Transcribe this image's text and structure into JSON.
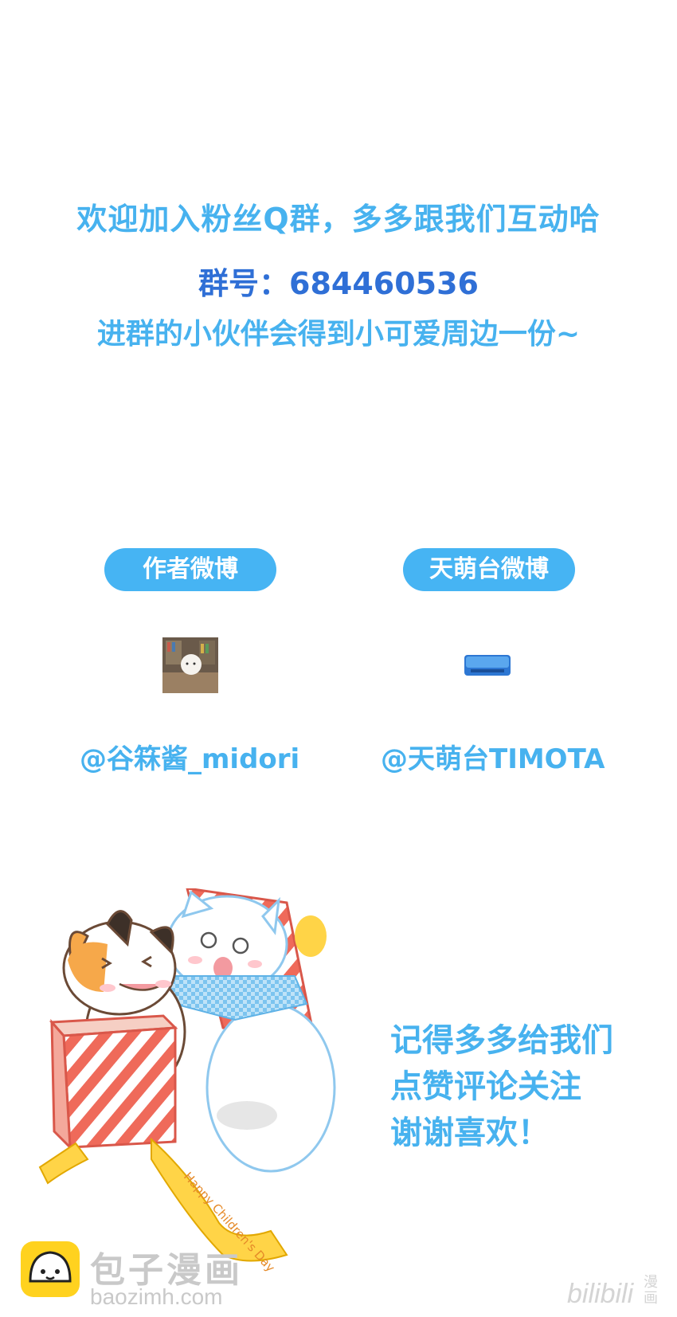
{
  "group_invite": {
    "line1": "欢迎加入粉丝Q群，多多跟我们互动哈",
    "line2": "群号：684460536",
    "line3": "进群的小伙伴会得到小可爱周边一份~"
  },
  "weibo": {
    "author_button": "作者微博",
    "studio_button": "天萌台微博",
    "author_handle": "@谷箖酱_midori",
    "studio_handle": "@天萌台TIMOTA"
  },
  "closing": {
    "line1": "记得多多给我们",
    "line2": "点赞评论关注",
    "line3": "谢谢喜欢！"
  },
  "illustration": {
    "ribbon_text": "Happy Children's Day"
  },
  "watermarks": {
    "site_name": "包子漫画",
    "site_url": "baozimh.com",
    "platform": "bilibili",
    "platform_sub": "漫画"
  },
  "colors": {
    "text_blue": "#47b2ef",
    "number_blue": "#2f6fd6",
    "pill_blue": "#46b4f3"
  }
}
